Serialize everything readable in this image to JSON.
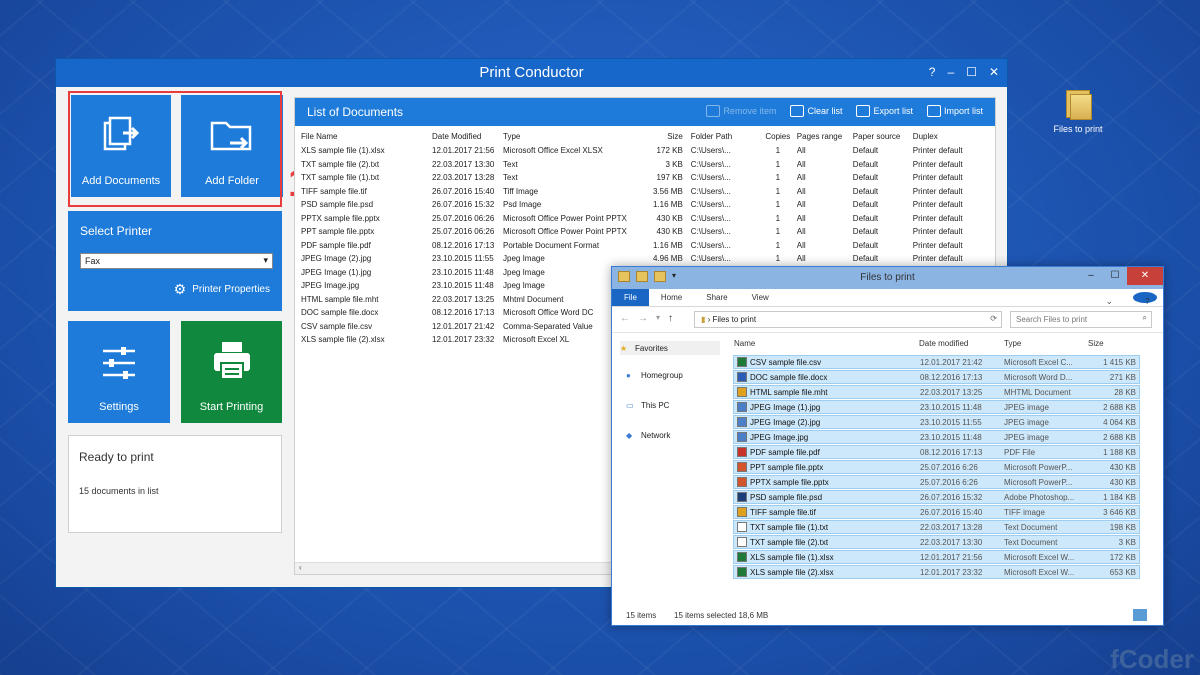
{
  "desktop": {
    "icon_label": "Files to print",
    "watermark": "fCoder"
  },
  "app": {
    "title": "Print Conductor",
    "title_controls": [
      "?",
      "–",
      "☐",
      "✕"
    ],
    "tiles": {
      "add_documents": "Add Documents",
      "add_folder": "Add Folder",
      "settings": "Settings",
      "start_printing": "Start Printing"
    },
    "step_badge": "1",
    "printer": {
      "caption": "Select Printer",
      "selected": "Fax",
      "properties": "Printer Properties"
    },
    "status": {
      "title": "Ready to print",
      "count": "15 documents in list"
    },
    "list": {
      "title": "List of Documents",
      "tools": [
        "Remove item",
        "Clear list",
        "Export list",
        "Import list"
      ],
      "columns": [
        "File Name",
        "Date Modified",
        "Type",
        "Size",
        "Folder Path",
        "Copies",
        "Pages range",
        "Paper source",
        "Duplex"
      ],
      "rows": [
        [
          "XLS sample file (1).xlsx",
          "12.01.2017 21:56",
          "Microsoft Office Excel XLSX",
          "172 KB",
          "C:\\Users\\...",
          "1",
          "All",
          "Default",
          "Printer default"
        ],
        [
          "TXT sample file (2).txt",
          "22.03.2017 13:30",
          "Text",
          "3 KB",
          "C:\\Users\\...",
          "1",
          "All",
          "Default",
          "Printer default"
        ],
        [
          "TXT sample file (1).txt",
          "22.03.2017 13:28",
          "Text",
          "197 KB",
          "C:\\Users\\...",
          "1",
          "All",
          "Default",
          "Printer default"
        ],
        [
          "TIFF sample file.tif",
          "26.07.2016 15:40",
          "Tiff Image",
          "3.56 MB",
          "C:\\Users\\...",
          "1",
          "All",
          "Default",
          "Printer default"
        ],
        [
          "PSD sample file.psd",
          "26.07.2016 15:32",
          "Psd Image",
          "1.16 MB",
          "C:\\Users\\...",
          "1",
          "All",
          "Default",
          "Printer default"
        ],
        [
          "PPTX sample file.pptx",
          "25.07.2016 06:26",
          "Microsoft Office Power Point PPTX",
          "430 KB",
          "C:\\Users\\...",
          "1",
          "All",
          "Default",
          "Printer default"
        ],
        [
          "PPT sample file.pptx",
          "25.07.2016 06:26",
          "Microsoft Office Power Point PPTX",
          "430 KB",
          "C:\\Users\\...",
          "1",
          "All",
          "Default",
          "Printer default"
        ],
        [
          "PDF sample file.pdf",
          "08.12.2016 17:13",
          "Portable Document Format",
          "1.16 MB",
          "C:\\Users\\...",
          "1",
          "All",
          "Default",
          "Printer default"
        ],
        [
          "JPEG Image (2).jpg",
          "23.10.2015 11:55",
          "Jpeg Image",
          "4.96 MB",
          "C:\\Users\\...",
          "1",
          "All",
          "Default",
          "Printer default"
        ],
        [
          "JPEG Image (1).jpg",
          "23.10.2015 11:48",
          "Jpeg Image",
          "",
          "",
          "",
          "",
          "",
          ""
        ],
        [
          "JPEG Image.jpg",
          "23.10.2015 11:48",
          "Jpeg Image",
          "",
          "",
          "",
          "",
          "",
          ""
        ],
        [
          "HTML sample file.mht",
          "22.03.2017 13:25",
          "Mhtml Document",
          "",
          "",
          "",
          "",
          "",
          ""
        ],
        [
          "DOC sample file.docx",
          "08.12.2016 17:13",
          "Microsoft Office Word DC",
          "",
          "",
          "",
          "",
          "",
          ""
        ],
        [
          "CSV sample file.csv",
          "12.01.2017 21:42",
          "Comma-Separated Value",
          "",
          "",
          "",
          "",
          "",
          ""
        ],
        [
          "XLS sample file (2).xlsx",
          "12.01.2017 23:32",
          "Microsoft Excel XL",
          "",
          "",
          "",
          "",
          "",
          ""
        ]
      ]
    }
  },
  "explorer": {
    "title": "Files to print",
    "ribbon": [
      "File",
      "Home",
      "Share",
      "View"
    ],
    "address": "Files to print",
    "search_placeholder": "Search Files to print",
    "nav": [
      "Favorites",
      "Homegroup",
      "This PC",
      "Network"
    ],
    "columns": [
      "Name",
      "Date modified",
      "Type",
      "Size"
    ],
    "files": [
      {
        "name": "CSV sample file.csv",
        "date": "12.01.2017 21:42",
        "type": "Microsoft Excel C...",
        "size": "1 415 KB",
        "color": "#1f7a3a"
      },
      {
        "name": "DOC sample file.docx",
        "date": "08.12.2016 17:13",
        "type": "Microsoft Word D...",
        "size": "271 KB",
        "color": "#2b5cb6"
      },
      {
        "name": "HTML sample file.mht",
        "date": "22.03.2017 13:25",
        "type": "MHTML Document",
        "size": "28 KB",
        "color": "#e0a020"
      },
      {
        "name": "JPEG Image (1).jpg",
        "date": "23.10.2015 11:48",
        "type": "JPEG image",
        "size": "2 688 KB",
        "color": "#4b7fc7"
      },
      {
        "name": "JPEG Image (2).jpg",
        "date": "23.10.2015 11:55",
        "type": "JPEG image",
        "size": "4 064 KB",
        "color": "#4b7fc7"
      },
      {
        "name": "JPEG Image.jpg",
        "date": "23.10.2015 11:48",
        "type": "JPEG image",
        "size": "2 688 KB",
        "color": "#4b7fc7"
      },
      {
        "name": "PDF sample file.pdf",
        "date": "08.12.2016 17:13",
        "type": "PDF File",
        "size": "1 188 KB",
        "color": "#c8332b"
      },
      {
        "name": "PPT sample file.pptx",
        "date": "25.07.2016 6:26",
        "type": "Microsoft PowerP...",
        "size": "430 KB",
        "color": "#d2552b"
      },
      {
        "name": "PPTX sample file.pptx",
        "date": "25.07.2016 6:26",
        "type": "Microsoft PowerP...",
        "size": "430 KB",
        "color": "#d2552b"
      },
      {
        "name": "PSD sample file.psd",
        "date": "26.07.2016 15:32",
        "type": "Adobe Photoshop...",
        "size": "1 184 KB",
        "color": "#1c3f7a"
      },
      {
        "name": "TIFF sample file.tif",
        "date": "26.07.2016 15:40",
        "type": "TIFF image",
        "size": "3 646 KB",
        "color": "#e0a020"
      },
      {
        "name": "TXT sample file (1).txt",
        "date": "22.03.2017 13:28",
        "type": "Text Document",
        "size": "198 KB",
        "color": "#ffffff"
      },
      {
        "name": "TXT sample file (2).txt",
        "date": "22.03.2017 13:30",
        "type": "Text Document",
        "size": "3 KB",
        "color": "#ffffff"
      },
      {
        "name": "XLS sample file (1).xlsx",
        "date": "12.01.2017 21:56",
        "type": "Microsoft Excel W...",
        "size": "172 KB",
        "color": "#1f7a3a"
      },
      {
        "name": "XLS sample file (2).xlsx",
        "date": "12.01.2017 23:32",
        "type": "Microsoft Excel W...",
        "size": "653 KB",
        "color": "#1f7a3a"
      }
    ],
    "status_items": "15 items",
    "status_selected": "15 items selected  18,6 MB"
  }
}
